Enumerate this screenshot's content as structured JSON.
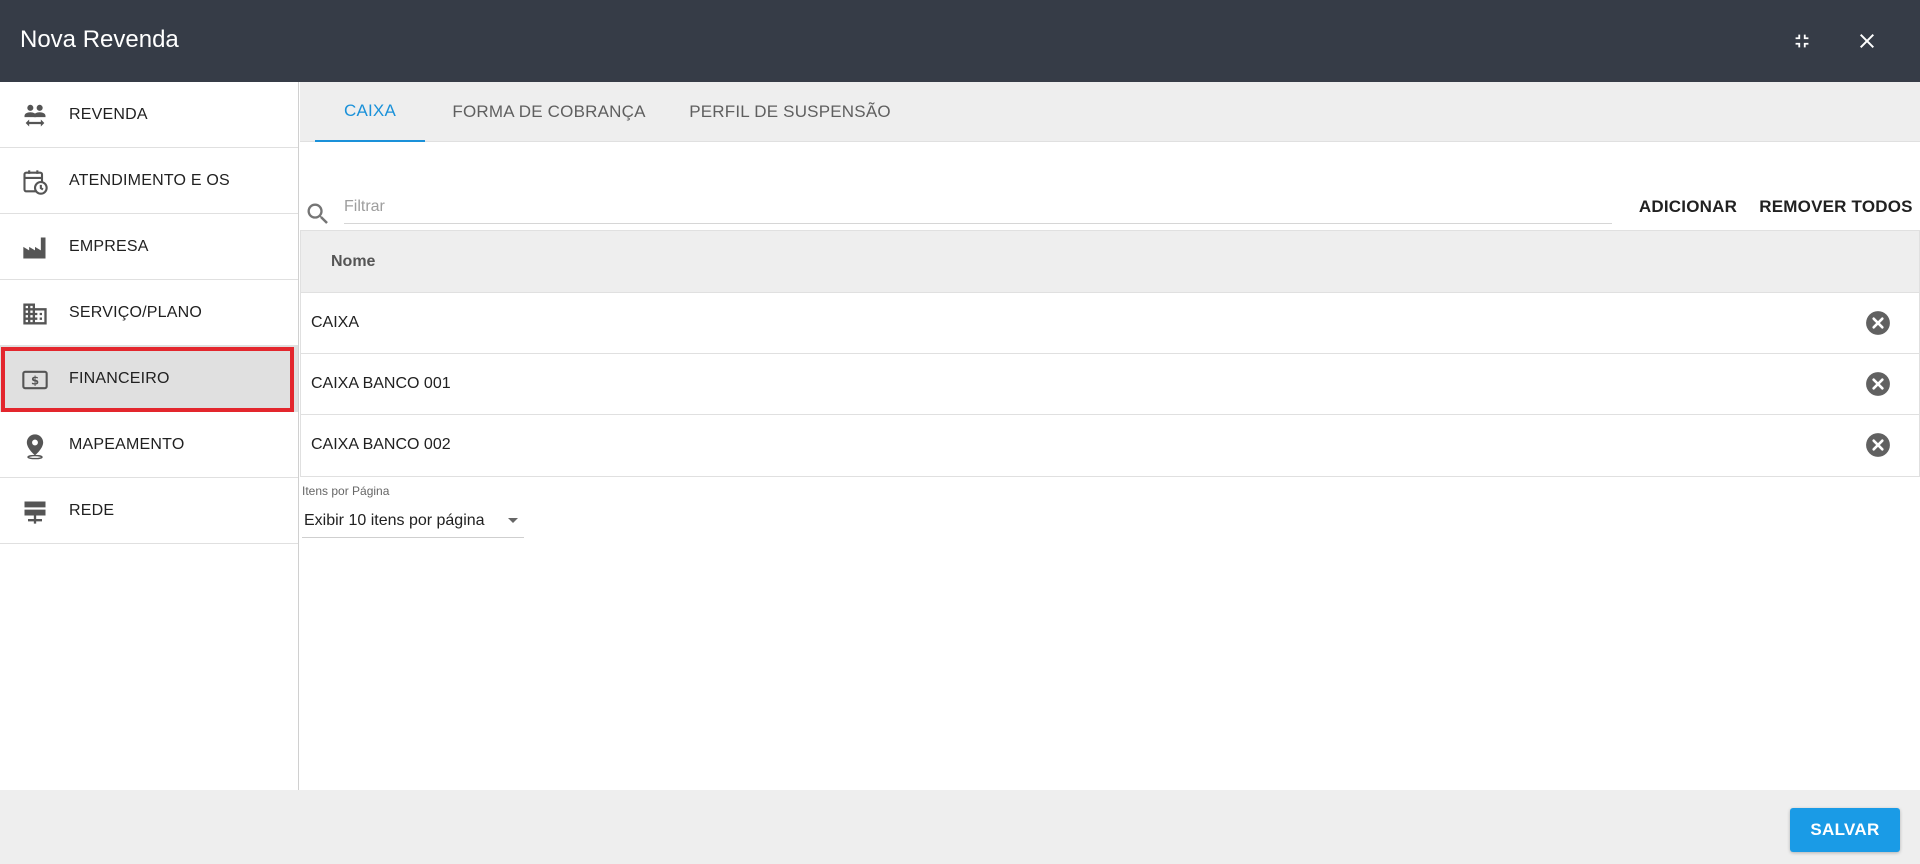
{
  "window": {
    "title": "Nova Revenda",
    "minimize_icon": "fullscreen-exit-icon",
    "close_icon": "close-icon"
  },
  "sidebar": {
    "items": [
      {
        "label": "REVENDA",
        "icon": "people-swap-icon"
      },
      {
        "label": "ATENDIMENTO E OS",
        "icon": "calendar-clock-icon"
      },
      {
        "label": "EMPRESA",
        "icon": "factory-icon"
      },
      {
        "label": "SERVIÇO/PLANO",
        "icon": "building-icon"
      },
      {
        "label": "FINANCEIRO",
        "icon": "money-icon",
        "active": true
      },
      {
        "label": "MAPEAMENTO",
        "icon": "location-pin-icon"
      },
      {
        "label": "REDE",
        "icon": "network-server-icon"
      }
    ]
  },
  "tabs": [
    {
      "label": "CAIXA",
      "active": true
    },
    {
      "label": "FORMA DE COBRANÇA"
    },
    {
      "label": "PERFIL DE SUSPENSÃO"
    }
  ],
  "toolbar": {
    "filter_placeholder": "Filtrar",
    "filter_value": "",
    "add_label": "ADICIONAR",
    "remove_all_label": "REMOVER TODOS"
  },
  "table": {
    "columns": [
      "Nome"
    ],
    "rows": [
      {
        "nome": "CAIXA"
      },
      {
        "nome": "CAIXA BANCO 001"
      },
      {
        "nome": "CAIXA BANCO 002"
      }
    ]
  },
  "pagination": {
    "label": "Itens por Página",
    "selected": "Exibir 10 itens por página"
  },
  "footer": {
    "save_label": "SALVAR"
  },
  "colors": {
    "header_bg": "#363c47",
    "accent": "#1a91d9",
    "highlight_border": "#e3262d",
    "save_bg": "#1a9be6"
  }
}
